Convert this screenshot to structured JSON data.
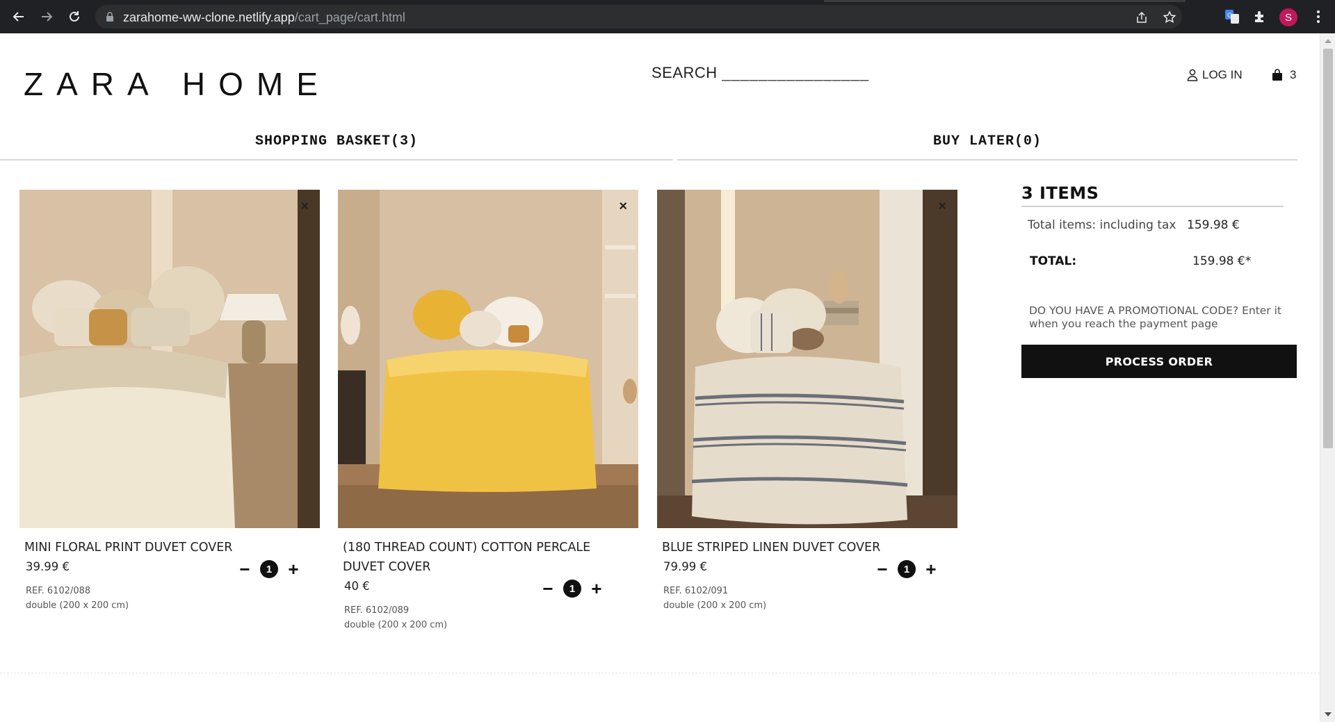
{
  "browser": {
    "url_host": "zarahome-ww-clone.netlify.app",
    "url_path": "/cart_page/cart.html",
    "profile_initial": "S"
  },
  "header": {
    "logo": "ZARA HOME",
    "search_label": "SEARCH",
    "search_placeholder": "________________",
    "login_label": "LOG IN",
    "cart_count": "3"
  },
  "tabs": {
    "basket": "SHOPPING BASKET(3)",
    "later": "BUY LATER(0)"
  },
  "products": [
    {
      "name": "MINI FLORAL PRINT DUVET COVER",
      "price": "39.99 €",
      "quantity": "1",
      "ref": "REF. 6102/088",
      "size": "double (200 x 200 cm)"
    },
    {
      "name": "(180 THREAD COUNT) COTTON PERCALE DUVET COVER",
      "price": "40 €",
      "quantity": "1",
      "ref": "REF. 6102/089",
      "size": "double (200 x 200 cm)"
    },
    {
      "name": "BLUE STRIPED LINEN DUVET COVER",
      "price": "79.99 €",
      "quantity": "1",
      "ref": "REF. 6102/091",
      "size": "double (200 x 200 cm)"
    }
  ],
  "controls": {
    "remove": "×",
    "minus": "−",
    "plus": "+"
  },
  "summary": {
    "items_heading": "3 ITEMS",
    "total_items_label": "Total items: including tax",
    "total_items_value": "159.98 €",
    "total_label": "TOTAL:",
    "total_value": "159.98 €*",
    "promo_text": "DO YOU HAVE A PROMOTIONAL CODE? Enter it when you reach the payment page",
    "process_button": "PROCESS ORDER"
  },
  "colors": {
    "chrome_bg": "#202124",
    "button_bg": "#111111",
    "avatar": "#c2185b"
  }
}
